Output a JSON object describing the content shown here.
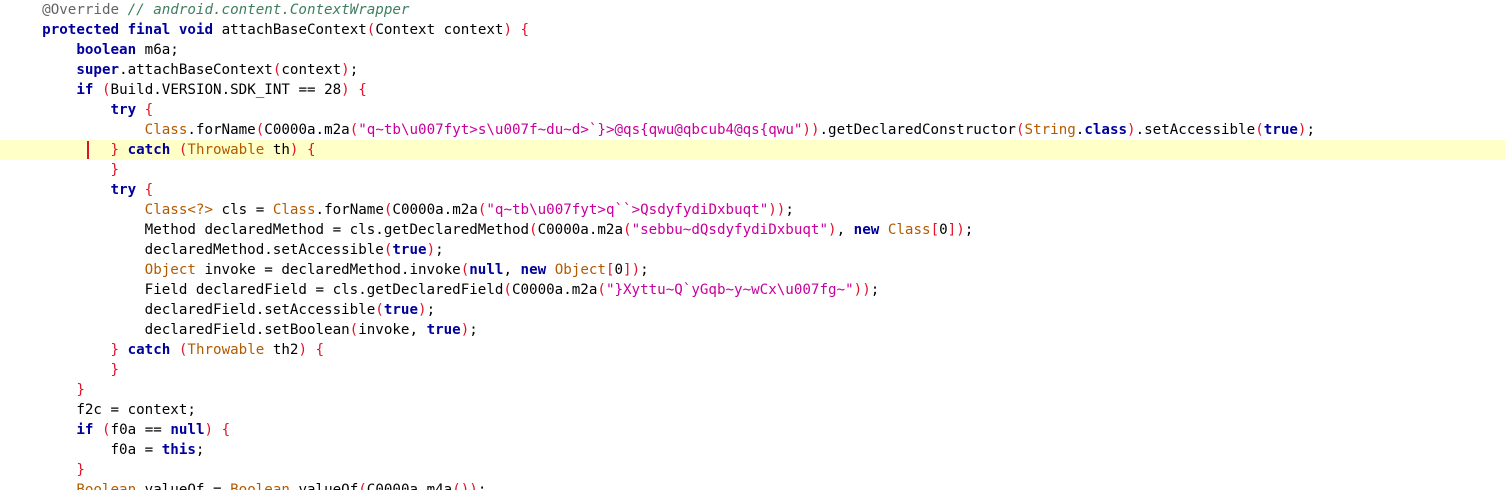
{
  "editor": {
    "current_line": 7,
    "colors": {
      "keyword": "#00009b",
      "string": "#c8009b",
      "class": "#b35a00",
      "comment": "#3f7f5f",
      "annotation": "#646464",
      "bracket": "#e0122b",
      "current_line_bg": "#ffffc8",
      "caret": "#e0122b"
    },
    "lines": [
      {
        "indent": "    ",
        "tokens": [
          {
            "t": "@Override ",
            "c": "ann"
          },
          {
            "t": "// android.content.ContextWrapper",
            "c": "cm"
          }
        ]
      },
      {
        "indent": "    ",
        "tokens": [
          {
            "t": "protected",
            "c": "kw"
          },
          {
            "t": " ",
            "c": "txt"
          },
          {
            "t": "final",
            "c": "kw"
          },
          {
            "t": " ",
            "c": "txt"
          },
          {
            "t": "void",
            "c": "kw"
          },
          {
            "t": " attachBaseContext",
            "c": "txt"
          },
          {
            "t": "(",
            "c": "br"
          },
          {
            "t": "Context context",
            "c": "txt"
          },
          {
            "t": ")",
            "c": "br"
          },
          {
            "t": " ",
            "c": "txt"
          },
          {
            "t": "{",
            "c": "br"
          }
        ]
      },
      {
        "indent": "        ",
        "tokens": [
          {
            "t": "boolean",
            "c": "kw"
          },
          {
            "t": " m6a;",
            "c": "txt"
          }
        ]
      },
      {
        "indent": "        ",
        "tokens": [
          {
            "t": "super",
            "c": "kw"
          },
          {
            "t": ".attachBaseContext",
            "c": "txt"
          },
          {
            "t": "(",
            "c": "br"
          },
          {
            "t": "context",
            "c": "txt"
          },
          {
            "t": ")",
            "c": "br"
          },
          {
            "t": ";",
            "c": "txt"
          }
        ]
      },
      {
        "indent": "        ",
        "tokens": [
          {
            "t": "if",
            "c": "kw"
          },
          {
            "t": " ",
            "c": "txt"
          },
          {
            "t": "(",
            "c": "br"
          },
          {
            "t": "Build.VERSION.SDK_INT == 28",
            "c": "txt"
          },
          {
            "t": ")",
            "c": "br"
          },
          {
            "t": " ",
            "c": "txt"
          },
          {
            "t": "{",
            "c": "br"
          }
        ]
      },
      {
        "indent": "            ",
        "tokens": [
          {
            "t": "try",
            "c": "kw"
          },
          {
            "t": " ",
            "c": "txt"
          },
          {
            "t": "{",
            "c": "br"
          }
        ]
      },
      {
        "indent": "                ",
        "tokens": [
          {
            "t": "Class",
            "c": "cls"
          },
          {
            "t": ".forName",
            "c": "txt"
          },
          {
            "t": "(",
            "c": "br"
          },
          {
            "t": "C0000a.m2a",
            "c": "txt"
          },
          {
            "t": "(",
            "c": "br"
          },
          {
            "t": "\"q~tb\\u007fyt>s\\u007f~du~d>`}>@qs{qwu@qbcub4@qs{qwu\"",
            "c": "str"
          },
          {
            "t": "))",
            "c": "br"
          },
          {
            "t": ".getDeclaredConstructor",
            "c": "txt"
          },
          {
            "t": "(",
            "c": "br"
          },
          {
            "t": "String",
            "c": "cls"
          },
          {
            "t": ".",
            "c": "txt"
          },
          {
            "t": "class",
            "c": "kw"
          },
          {
            "t": ")",
            "c": "br"
          },
          {
            "t": ".setAccessible",
            "c": "txt"
          },
          {
            "t": "(",
            "c": "br"
          },
          {
            "t": "true",
            "c": "kw"
          },
          {
            "t": ")",
            "c": "br"
          },
          {
            "t": ";",
            "c": "txt"
          }
        ]
      },
      {
        "indent": "            ",
        "tokens": [
          {
            "t": "}",
            "c": "br"
          },
          {
            "t": " ",
            "c": "txt"
          },
          {
            "t": "catch",
            "c": "kw"
          },
          {
            "t": " ",
            "c": "txt"
          },
          {
            "t": "(",
            "c": "br"
          },
          {
            "t": "Throwable",
            "c": "cls"
          },
          {
            "t": " th",
            "c": "txt"
          },
          {
            "t": ")",
            "c": "br"
          },
          {
            "t": " ",
            "c": "txt"
          },
          {
            "t": "{",
            "c": "br"
          }
        ]
      },
      {
        "indent": "            ",
        "tokens": [
          {
            "t": "}",
            "c": "br"
          }
        ]
      },
      {
        "indent": "            ",
        "tokens": [
          {
            "t": "try",
            "c": "kw"
          },
          {
            "t": " ",
            "c": "txt"
          },
          {
            "t": "{",
            "c": "br"
          }
        ]
      },
      {
        "indent": "                ",
        "tokens": [
          {
            "t": "Class<?>",
            "c": "cls"
          },
          {
            "t": " cls = ",
            "c": "txt"
          },
          {
            "t": "Class",
            "c": "cls"
          },
          {
            "t": ".forName",
            "c": "txt"
          },
          {
            "t": "(",
            "c": "br"
          },
          {
            "t": "C0000a.m2a",
            "c": "txt"
          },
          {
            "t": "(",
            "c": "br"
          },
          {
            "t": "\"q~tb\\u007fyt>q``>QsdyfydiDxbuqt\"",
            "c": "str"
          },
          {
            "t": "))",
            "c": "br"
          },
          {
            "t": ";",
            "c": "txt"
          }
        ]
      },
      {
        "indent": "                ",
        "tokens": [
          {
            "t": "Method declaredMethod = cls.getDeclaredMethod",
            "c": "txt"
          },
          {
            "t": "(",
            "c": "br"
          },
          {
            "t": "C0000a.m2a",
            "c": "txt"
          },
          {
            "t": "(",
            "c": "br"
          },
          {
            "t": "\"sebbu~dQsdyfydiDxbuqt\"",
            "c": "str"
          },
          {
            "t": ")",
            "c": "br"
          },
          {
            "t": ", ",
            "c": "txt"
          },
          {
            "t": "new",
            "c": "kw"
          },
          {
            "t": " ",
            "c": "txt"
          },
          {
            "t": "Class",
            "c": "cls"
          },
          {
            "t": "[",
            "c": "br"
          },
          {
            "t": "0",
            "c": "txt"
          },
          {
            "t": "])",
            "c": "br"
          },
          {
            "t": ";",
            "c": "txt"
          }
        ]
      },
      {
        "indent": "                ",
        "tokens": [
          {
            "t": "declaredMethod.setAccessible",
            "c": "txt"
          },
          {
            "t": "(",
            "c": "br"
          },
          {
            "t": "true",
            "c": "kw"
          },
          {
            "t": ")",
            "c": "br"
          },
          {
            "t": ";",
            "c": "txt"
          }
        ]
      },
      {
        "indent": "                ",
        "tokens": [
          {
            "t": "Object",
            "c": "cls"
          },
          {
            "t": " invoke = declaredMethod.invoke",
            "c": "txt"
          },
          {
            "t": "(",
            "c": "br"
          },
          {
            "t": "null",
            "c": "kw"
          },
          {
            "t": ", ",
            "c": "txt"
          },
          {
            "t": "new",
            "c": "kw"
          },
          {
            "t": " ",
            "c": "txt"
          },
          {
            "t": "Object",
            "c": "cls"
          },
          {
            "t": "[",
            "c": "br"
          },
          {
            "t": "0",
            "c": "txt"
          },
          {
            "t": "])",
            "c": "br"
          },
          {
            "t": ";",
            "c": "txt"
          }
        ]
      },
      {
        "indent": "                ",
        "tokens": [
          {
            "t": "Field declaredField = cls.getDeclaredField",
            "c": "txt"
          },
          {
            "t": "(",
            "c": "br"
          },
          {
            "t": "C0000a.m2a",
            "c": "txt"
          },
          {
            "t": "(",
            "c": "br"
          },
          {
            "t": "\"}Xyttu~Q`yGqb~y~wCx\\u007fg~\"",
            "c": "str"
          },
          {
            "t": "))",
            "c": "br"
          },
          {
            "t": ";",
            "c": "txt"
          }
        ]
      },
      {
        "indent": "                ",
        "tokens": [
          {
            "t": "declaredField.setAccessible",
            "c": "txt"
          },
          {
            "t": "(",
            "c": "br"
          },
          {
            "t": "true",
            "c": "kw"
          },
          {
            "t": ")",
            "c": "br"
          },
          {
            "t": ";",
            "c": "txt"
          }
        ]
      },
      {
        "indent": "                ",
        "tokens": [
          {
            "t": "declaredField.setBoolean",
            "c": "txt"
          },
          {
            "t": "(",
            "c": "br"
          },
          {
            "t": "invoke, ",
            "c": "txt"
          },
          {
            "t": "true",
            "c": "kw"
          },
          {
            "t": ")",
            "c": "br"
          },
          {
            "t": ";",
            "c": "txt"
          }
        ]
      },
      {
        "indent": "            ",
        "tokens": [
          {
            "t": "}",
            "c": "br"
          },
          {
            "t": " ",
            "c": "txt"
          },
          {
            "t": "catch",
            "c": "kw"
          },
          {
            "t": " ",
            "c": "txt"
          },
          {
            "t": "(",
            "c": "br"
          },
          {
            "t": "Throwable",
            "c": "cls"
          },
          {
            "t": " th2",
            "c": "txt"
          },
          {
            "t": ")",
            "c": "br"
          },
          {
            "t": " ",
            "c": "txt"
          },
          {
            "t": "{",
            "c": "br"
          }
        ]
      },
      {
        "indent": "            ",
        "tokens": [
          {
            "t": "}",
            "c": "br"
          }
        ]
      },
      {
        "indent": "        ",
        "tokens": [
          {
            "t": "}",
            "c": "br"
          }
        ]
      },
      {
        "indent": "        ",
        "tokens": [
          {
            "t": "f2c = context;",
            "c": "txt"
          }
        ]
      },
      {
        "indent": "        ",
        "tokens": [
          {
            "t": "if",
            "c": "kw"
          },
          {
            "t": " ",
            "c": "txt"
          },
          {
            "t": "(",
            "c": "br"
          },
          {
            "t": "f0a == ",
            "c": "txt"
          },
          {
            "t": "null",
            "c": "kw"
          },
          {
            "t": ")",
            "c": "br"
          },
          {
            "t": " ",
            "c": "txt"
          },
          {
            "t": "{",
            "c": "br"
          }
        ]
      },
      {
        "indent": "            ",
        "tokens": [
          {
            "t": "f0a = ",
            "c": "txt"
          },
          {
            "t": "this",
            "c": "kw"
          },
          {
            "t": ";",
            "c": "txt"
          }
        ]
      },
      {
        "indent": "        ",
        "tokens": [
          {
            "t": "}",
            "c": "br"
          }
        ]
      },
      {
        "indent": "        ",
        "tokens": [
          {
            "t": "Boolean",
            "c": "cls"
          },
          {
            "t": " valueOf = ",
            "c": "txt"
          },
          {
            "t": "Boolean",
            "c": "cls"
          },
          {
            "t": ".valueOf",
            "c": "txt"
          },
          {
            "t": "(",
            "c": "br"
          },
          {
            "t": "C0000a.m4a",
            "c": "txt"
          },
          {
            "t": "())",
            "c": "br"
          },
          {
            "t": ";",
            "c": "txt"
          }
        ]
      }
    ]
  }
}
